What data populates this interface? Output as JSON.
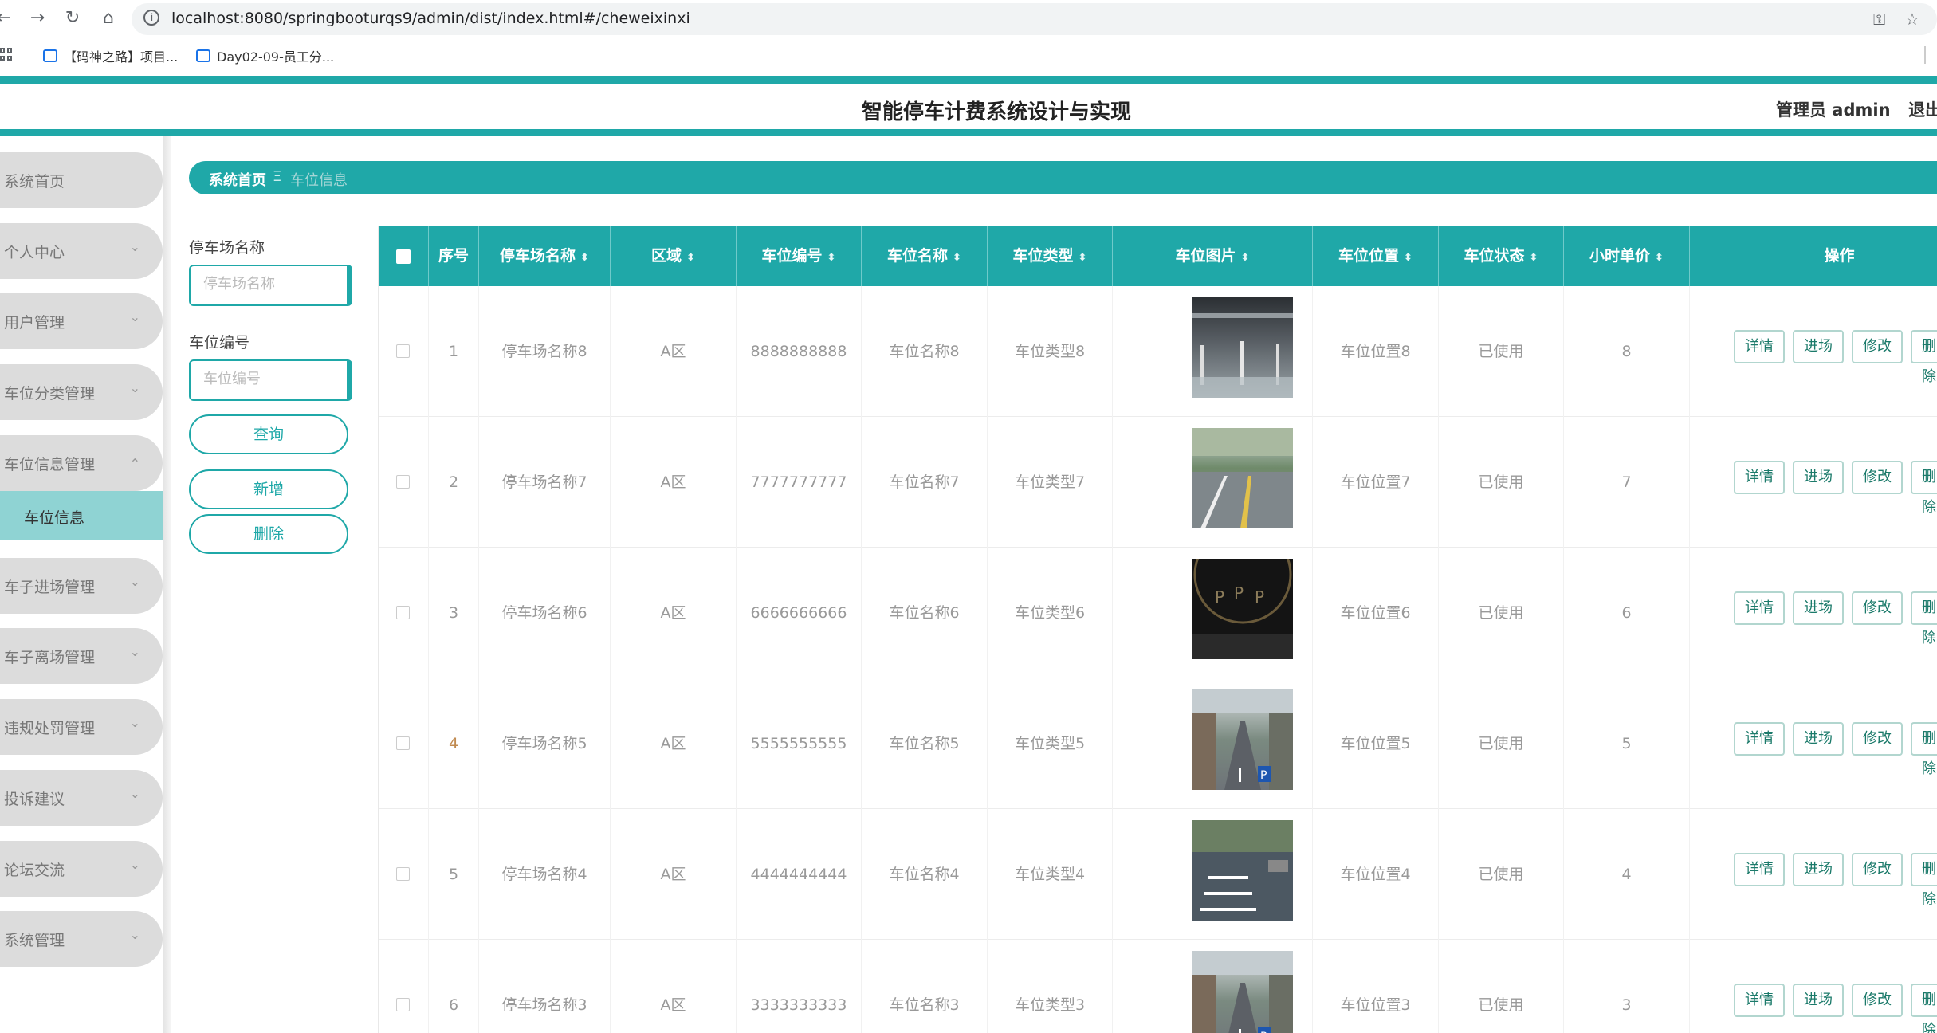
{
  "browser": {
    "url": "localhost:8080/springbooturqs9/admin/dist/index.html#/cheweixinxi",
    "bookmarks": [
      "【码神之路】项目...",
      "Day02-09-员工分..."
    ],
    "icons": [
      "back-arrow-icon",
      "forward-arrow-icon",
      "reload-icon",
      "home-icon",
      "info-icon",
      "key-icon",
      "star-icon",
      "apps-grid-icon",
      "bookmark-icon"
    ]
  },
  "header": {
    "title": "智能停车计费系统设计与实现",
    "admin_label": "管理员 admin",
    "logout_label": "退出"
  },
  "sidebar": {
    "items": [
      {
        "label": "系统首页",
        "has_arrow": false
      },
      {
        "label": "个人中心",
        "has_arrow": true
      },
      {
        "label": "用户管理",
        "has_arrow": true
      },
      {
        "label": "车位分类管理",
        "has_arrow": true
      },
      {
        "label": "车位信息管理",
        "has_arrow": true,
        "expanded": true
      },
      {
        "label": "车子进场管理",
        "has_arrow": true
      },
      {
        "label": "车子离场管理",
        "has_arrow": true
      },
      {
        "label": "违规处罚管理",
        "has_arrow": true
      },
      {
        "label": "投诉建议",
        "has_arrow": true
      },
      {
        "label": "论坛交流",
        "has_arrow": true
      },
      {
        "label": "系统管理",
        "has_arrow": true
      }
    ],
    "active_sub": "车位信息"
  },
  "breadcrumb": {
    "home": "系统首页",
    "separator": "Ξ",
    "current": "车位信息"
  },
  "search": {
    "lot_label": "停车场名称",
    "lot_placeholder": "停车场名称",
    "space_label": "车位编号",
    "space_placeholder": "车位编号",
    "query_button": "查询",
    "add_button": "新增",
    "delete_button": "删除"
  },
  "table": {
    "columns": [
      "序号",
      "停车场名称",
      "区域",
      "车位编号",
      "车位名称",
      "车位类型",
      "车位图片",
      "车位位置",
      "车位状态",
      "小时单价",
      "操作"
    ],
    "sortable": [
      false,
      true,
      true,
      true,
      true,
      true,
      true,
      true,
      true,
      true,
      false
    ],
    "actions": [
      "详情",
      "进场",
      "修改",
      "删除"
    ],
    "rows": [
      {
        "index": "1",
        "lot": "停车场名称8",
        "area": "A区",
        "code": "8888888888",
        "name": "车位名称8",
        "type": "车位类型8",
        "location": "车位位置8",
        "status": "已使用",
        "price": "8",
        "image": "garage-interior"
      },
      {
        "index": "2",
        "lot": "停车场名称7",
        "area": "A区",
        "code": "7777777777",
        "name": "车位名称7",
        "type": "车位类型7",
        "location": "车位位置7",
        "status": "已使用",
        "price": "7",
        "image": "outdoor-lot"
      },
      {
        "index": "3",
        "lot": "停车场名称6",
        "area": "A区",
        "code": "6666666666",
        "name": "车位名称6",
        "type": "车位类型6",
        "location": "车位位置6",
        "status": "已使用",
        "price": "6",
        "image": "dark-parking-signs"
      },
      {
        "index": "4",
        "lot": "停车场名称5",
        "area": "A区",
        "code": "5555555555",
        "name": "车位名称5",
        "type": "车位类型5",
        "location": "车位位置5",
        "status": "已使用",
        "price": "5",
        "image": "street-parking"
      },
      {
        "index": "5",
        "lot": "停车场名称4",
        "area": "A区",
        "code": "4444444444",
        "name": "车位名称4",
        "type": "车位类型4",
        "location": "车位位置4",
        "status": "已使用",
        "price": "4",
        "image": "marked-spaces"
      },
      {
        "index": "6",
        "lot": "停车场名称3",
        "area": "A区",
        "code": "3333333333",
        "name": "车位名称3",
        "type": "车位类型3",
        "location": "车位位置3",
        "status": "已使用",
        "price": "3",
        "image": "street-parking"
      }
    ]
  },
  "colors": {
    "accent": "#1fa8a8",
    "sidebar_item": "#dcdcdc",
    "sidebar_active": "#8fd3d3",
    "action_text": "#1b7a6a"
  }
}
